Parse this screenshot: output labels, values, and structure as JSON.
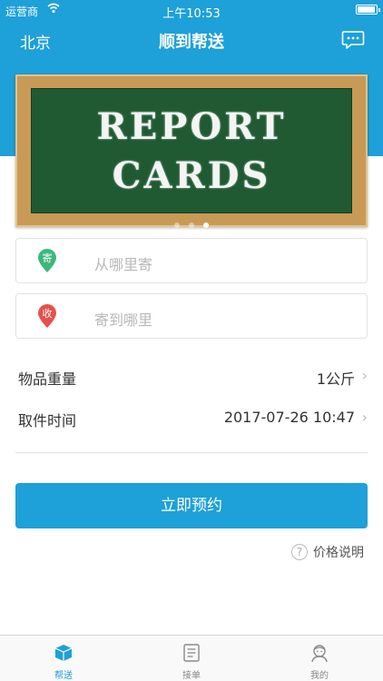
{
  "status_bar": {
    "carrier": "运营商",
    "time": "上午10:53"
  },
  "nav": {
    "city": "北京",
    "title": "顺到帮送",
    "chat_icon": "chat-bubble-icon"
  },
  "banner": {
    "line1": "REPORT",
    "line2": "CARDS",
    "slide_count": 3,
    "active_slide": 3
  },
  "address": {
    "send": {
      "pin_label": "寄",
      "placeholder": "从哪里寄",
      "pin_color": "#3cb87a"
    },
    "receive": {
      "pin_label": "收",
      "placeholder": "寄到哪里",
      "pin_color": "#e8504a"
    }
  },
  "rows": {
    "weight": {
      "label": "物品重量",
      "value": "1公斤"
    },
    "pickup_time": {
      "label": "取件时间",
      "value": "2017-07-26 10:47"
    }
  },
  "actions": {
    "book_label": "立即预约",
    "price_help_label": "价格说明"
  },
  "tabs": [
    {
      "label": "帮送",
      "icon": "box-icon",
      "active": true
    },
    {
      "label": "接单",
      "icon": "order-list-icon",
      "active": false
    },
    {
      "label": "我的",
      "icon": "profile-icon",
      "active": false
    }
  ],
  "colors": {
    "primary": "#1ea0d8",
    "send_pin": "#3cb87a",
    "receive_pin": "#e8504a"
  }
}
